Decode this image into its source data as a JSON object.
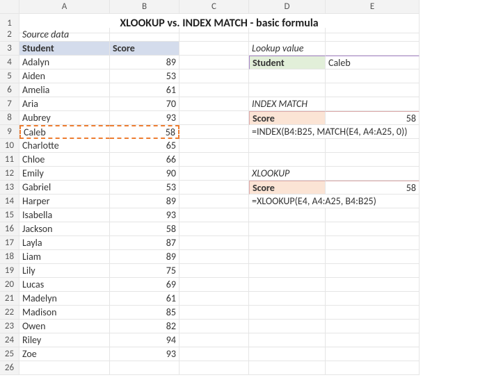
{
  "columns": [
    "A",
    "B",
    "C",
    "D",
    "E"
  ],
  "title": "XLOOKUP vs. INDEX MATCH - basic formula",
  "source_label": "Source data",
  "table_headers": {
    "student": "Student",
    "score": "Score"
  },
  "students": [
    {
      "name": "Adalyn",
      "score": 89
    },
    {
      "name": "Aiden",
      "score": 53
    },
    {
      "name": "Amelia",
      "score": 61
    },
    {
      "name": "Aria",
      "score": 70
    },
    {
      "name": "Aubrey",
      "score": 93
    },
    {
      "name": "Caleb",
      "score": 58
    },
    {
      "name": "Charlotte",
      "score": 65
    },
    {
      "name": "Chloe",
      "score": 66
    },
    {
      "name": "Emily",
      "score": 90
    },
    {
      "name": "Gabriel",
      "score": 53
    },
    {
      "name": "Harper",
      "score": 89
    },
    {
      "name": "Isabella",
      "score": 93
    },
    {
      "name": "Jackson",
      "score": 58
    },
    {
      "name": "Layla",
      "score": 87
    },
    {
      "name": "Liam",
      "score": 89
    },
    {
      "name": "Lily",
      "score": 75
    },
    {
      "name": "Lucas",
      "score": 69
    },
    {
      "name": "Madelyn",
      "score": 61
    },
    {
      "name": "Madison",
      "score": 85
    },
    {
      "name": "Owen",
      "score": 82
    },
    {
      "name": "Riley",
      "score": 94
    },
    {
      "name": "Zoe",
      "score": 93
    }
  ],
  "lookup": {
    "section": "Lookup value",
    "label": "Student",
    "value": "Caleb"
  },
  "index_match": {
    "section": "INDEX MATCH",
    "label": "Score",
    "result": 58,
    "formula": "=INDEX(B4:B25, MATCH(E4, A4:A25, 0))"
  },
  "xlookup": {
    "section": "XLOOKUP",
    "label": "Score",
    "result": 58,
    "formula": "=XLOOKUP(E4, A4:A25, B4:B25)"
  }
}
